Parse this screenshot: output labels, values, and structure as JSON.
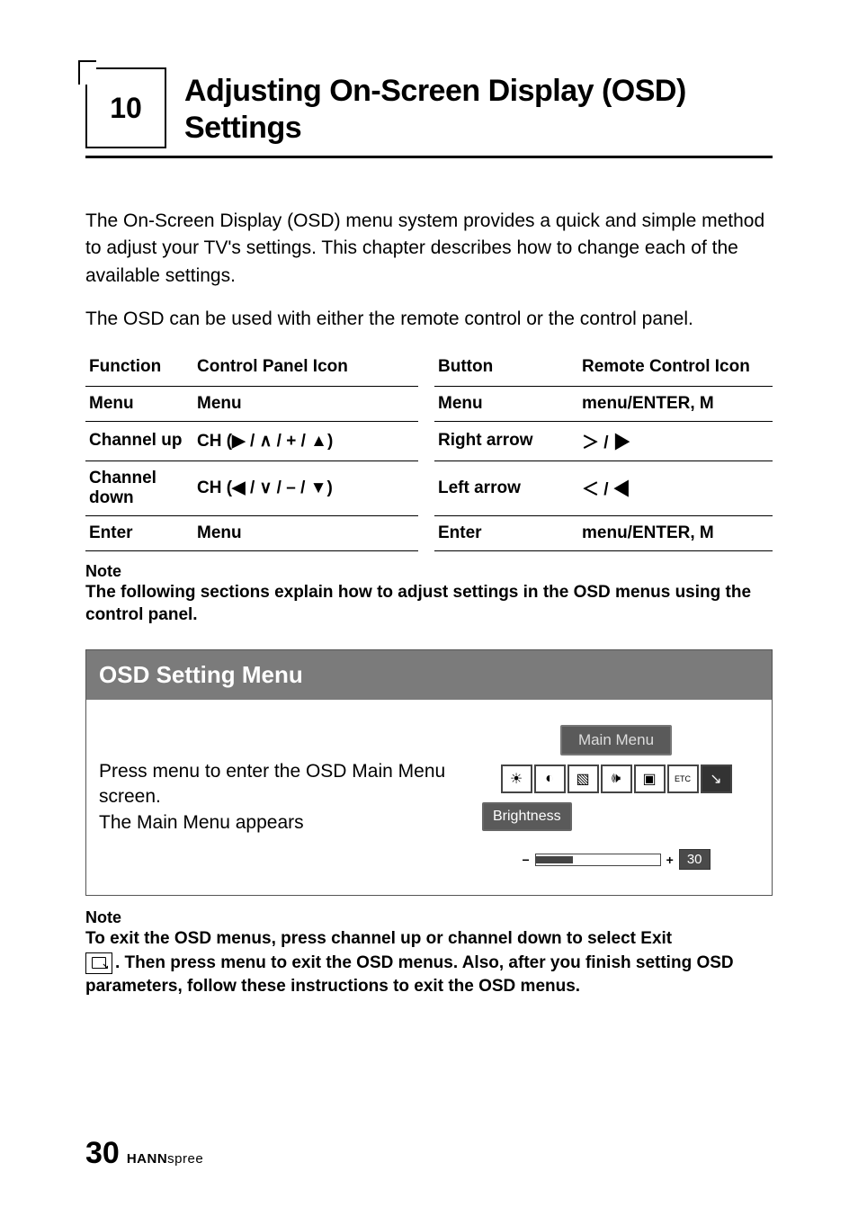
{
  "chapter": {
    "number": "10",
    "title": "Adjusting On-Screen Display (OSD) Settings"
  },
  "intro": {
    "p1": "The On-Screen Display (OSD) menu system provides a quick and simple method to adjust your TV's settings. This chapter describes how to change each of the available settings.",
    "p2": "The OSD can be used with either the remote control or the control panel."
  },
  "table": {
    "headers": {
      "function": "Function",
      "control_panel_icon": "Control Panel Icon",
      "button": "Button",
      "remote_control_icon": "Remote Control Icon"
    },
    "rows": [
      {
        "function": "Menu",
        "cpi": "Menu",
        "button": "Menu",
        "rci": "menu/ENTER, M"
      },
      {
        "function": "Channel up",
        "cpi": "CH (▶ / ∧ / + / ▲)",
        "button": "Right arrow",
        "rci": "＞ / ▶"
      },
      {
        "function": "Channel down",
        "cpi": "CH (◀ / ∨ / – / ▼)",
        "button": "Left arrow",
        "rci": "＜ / ◀"
      },
      {
        "function": "Enter",
        "cpi": "Menu",
        "button": "Enter",
        "rci": "menu/ENTER, M"
      }
    ]
  },
  "note1": {
    "label": "Note",
    "text": "The following sections explain how to adjust settings in the OSD menus using the control panel."
  },
  "section": {
    "header": "OSD Setting Menu",
    "body": "Press menu to enter the OSD Main Menu screen.\nThe Main Menu appears",
    "osd": {
      "main_menu_label": "Main  Menu",
      "brightness_label": "Brightness",
      "slider_value": "30"
    }
  },
  "note2": {
    "label": "Note",
    "line1": "To exit the OSD menus, press channel up or channel down to select Exit",
    "line2a": ". Then press menu to exit the OSD menus. Also, after you finish setting OSD parameters, follow these instructions to exit the OSD menus."
  },
  "footer": {
    "page_number": "30",
    "brand_bold": "HANN",
    "brand_light": "spree"
  }
}
